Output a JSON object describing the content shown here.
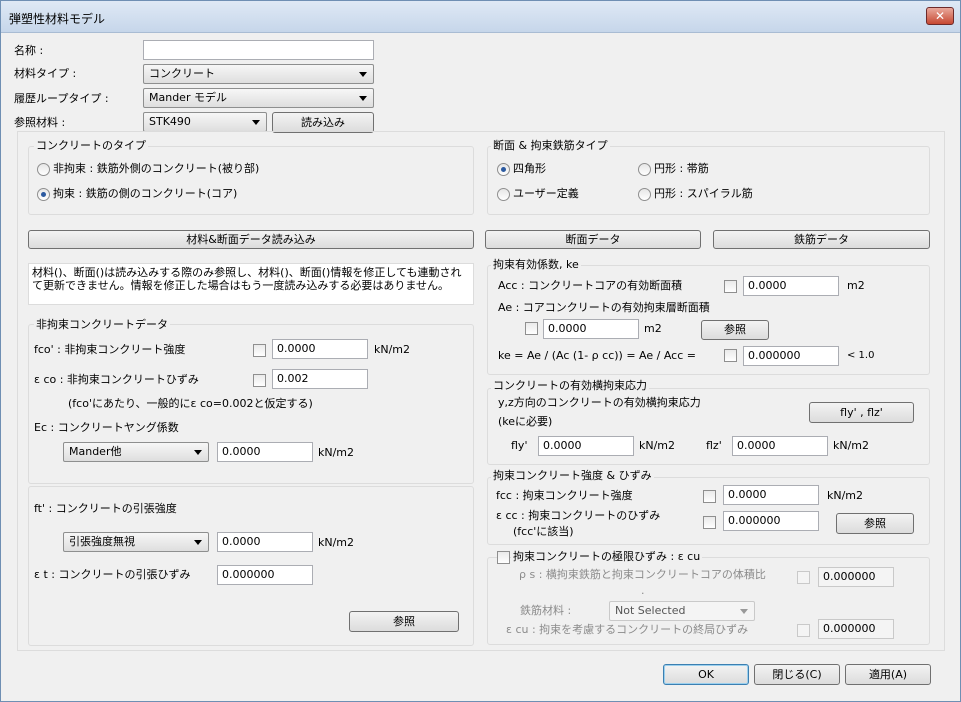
{
  "window": {
    "title": "弾塑性材料モデル",
    "close_glyph": "✕"
  },
  "top": {
    "name_label": "名称 :",
    "name_value": "",
    "material_type_label": "材料タイプ :",
    "material_type_value": "コンクリート",
    "hysteresis_label": "履歴ループタイプ :",
    "hysteresis_value": "Mander モデル",
    "ref_material_label": "参照材料 :",
    "ref_material_value": "STK490",
    "load_button": "読み込み"
  },
  "concrete_type": {
    "title": "コンクリートのタイプ",
    "options": [
      "非拘束 : 鉄筋外側のコンクリート(被り部)",
      "拘束 : 鉄筋の側のコンクリート(コア)"
    ],
    "selected": 1
  },
  "section_type": {
    "title": "断面 & 拘束鉄筋タイプ",
    "options": [
      "四角形",
      "円形 : 帯筋",
      "ユーザー定義",
      "円形 : スパイラル筋"
    ],
    "selected": 0
  },
  "buttons": {
    "load_material_section": "材料&断面データ読み込み",
    "section_data": "断面データ",
    "rebar_data": "鉄筋データ",
    "ok": "OK",
    "close": "閉じる(C)",
    "apply": "適用(A)"
  },
  "note": "材料()、断面()は読み込みする際のみ参照し、材料()、断面()情報を修正しても連動されて更新できません。情報を修正した場合はもう一度読み込みする必要はありません。",
  "unconfined": {
    "title": "非拘束コンクリートデータ",
    "fco_label": "fco' : 非拘束コンクリート強度",
    "fco_value": "0.0000",
    "fco_unit": "kN/m2",
    "eco_label": "ε co : 非拘束コンクリートひずみ",
    "eco_value": "0.002",
    "eco_note": "(fco'にあたり、一般的にε co=0.002と仮定する)",
    "ec_label": "Ec : コンクリートヤング係数",
    "ec_method": "Mander他",
    "ec_value": "0.0000",
    "ec_unit": "kN/m2"
  },
  "tension": {
    "ft_label": "ft' : コンクリートの引張強度",
    "ft_method": "引張強度無視",
    "ft_value": "0.0000",
    "ft_unit": "kN/m2",
    "et_label": "ε t : コンクリートの引張ひずみ",
    "et_value": "0.000000",
    "ref_button": "参照"
  },
  "ke": {
    "title": "拘束有効係数, ke",
    "acc_label": "Acc : コンクリートコアの有効断面積",
    "acc_value": "0.0000",
    "acc_unit": "m2",
    "ae_label": "Ae : コアコンクリートの有効拘束層断面積",
    "ae_value": "0.0000",
    "ae_unit": "m2",
    "ref_button": "参照",
    "ke_label": "ke = Ae / (Ac (1- ρ cc)) = Ae / Acc =",
    "ke_value": "0.000000",
    "ke_limit": "< 1.0"
  },
  "lateral": {
    "title": "コンクリートの有効横拘束応力",
    "desc1": "y,z方向のコンクリートの有効横拘束応力",
    "desc2": "(keに必要)",
    "button": "fly' , flz'",
    "fly_label": "fly'",
    "fly_value": "0.0000",
    "fly_unit": "kN/m2",
    "flz_label": "flz'",
    "flz_value": "0.0000",
    "flz_unit": "kN/m2"
  },
  "confined": {
    "title": "拘束コンクリート強度 & ひずみ",
    "fcc_label": "fcc : 拘束コンクリート強度",
    "fcc_value": "0.0000",
    "fcc_unit": "kN/m2",
    "ecc_label": "ε cc : 拘束コンクリートのひずみ",
    "ecc_sub": "(fcc'に該当)",
    "ecc_value": "0.000000",
    "ref_button": "参照"
  },
  "ultimate": {
    "title": "拘束コンクリートの極限ひずみ : ε cu",
    "rho_label": "ρ s : 横拘束鉄筋と拘束コンクリートコアの体積比",
    "rho_value": "0.000000",
    "dot": ".",
    "rebar_label": "鉄筋材料 :",
    "rebar_value": "Not Selected",
    "ecu_label": "ε cu : 拘束を考慮するコンクリートの終局ひずみ",
    "ecu_value": "0.000000"
  }
}
